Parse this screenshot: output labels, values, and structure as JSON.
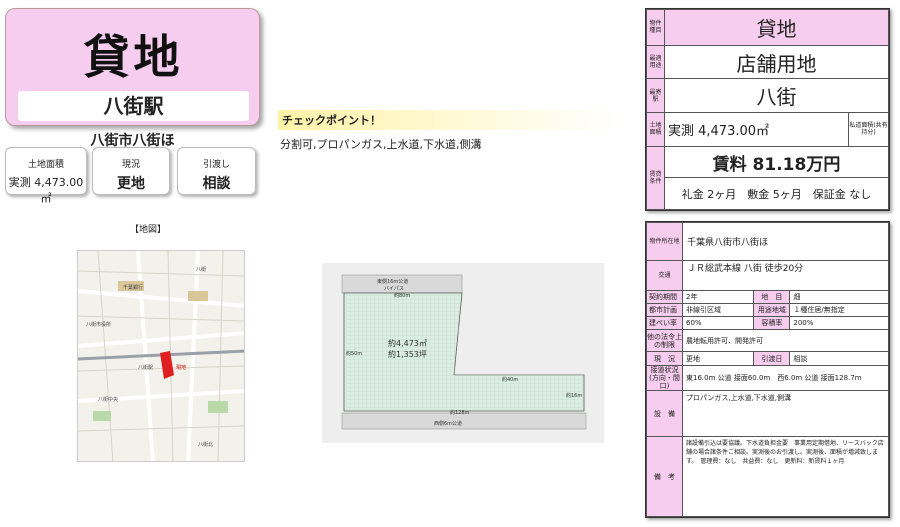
{
  "title": {
    "main": "貸地",
    "station": "八街駅"
  },
  "address_short": "八街市八街ほ",
  "info_boxes": [
    {
      "label": "土地面積",
      "value": "実測 4,473.00㎡"
    },
    {
      "label": "現況",
      "value": "更地"
    },
    {
      "label": "引渡し",
      "value": "相談"
    }
  ],
  "map": {
    "caption": "【地図】",
    "labels": [
      "八街",
      "千葉銀行",
      "八街市役所",
      "八街駅",
      "現地",
      "八街中央",
      "八街北"
    ]
  },
  "checkpoint": {
    "title": "チェックポイント！",
    "text": "分割可,プロパンガス,上水道,下水道,側溝"
  },
  "plan": {
    "top_road": "東側16m公道",
    "top_note": "バイパス",
    "top_len": "約80m",
    "left_len": "約50m",
    "area_sqm": "約4,473㎡",
    "area_tsubo": "約1,353坪",
    "inner_len": "約40m",
    "right_len": "約16m",
    "bottom_len": "約128m",
    "bottom_road": "西側6m公道"
  },
  "summary": {
    "type_label": "物件種目",
    "type": "貸地",
    "use_label": "最適用途",
    "use": "店舗用地",
    "station_label": "最寄駅",
    "station": "八街",
    "area_label": "土地面積",
    "area": "実測 4,473.00㎡",
    "area_note": "私道面積(共有持分)",
    "rent_label": "賃貸条件",
    "rent": "賃料 81.18万円",
    "conditions": "礼金 2ヶ月　敷金 5ヶ月　保証金 なし"
  },
  "details": {
    "location_label": "物件所在地",
    "location": "千葉県八街市八街ほ",
    "transport_label": "交通",
    "transport": "ＪＲ総武本線 八街 徒歩20分",
    "rows": [
      {
        "l1": "契約期間",
        "v1": "2年",
        "l2": "地　目",
        "v2": "畑"
      },
      {
        "l1": "都市計画",
        "v1": "非線引区域",
        "l2": "用途地域",
        "v2": "１種住居/無指定"
      },
      {
        "l1": "建ぺい率",
        "v1": "60%",
        "l2": "容積率",
        "v2": "200%"
      }
    ],
    "other_label": "他の法令上の制限",
    "other": "農地転用許可、開発許可",
    "status_label": "現　況",
    "status": "更地",
    "delivery_label": "引渡日",
    "delivery": "相談",
    "road_label": "接道状況(方向・間口)",
    "road": "東16.0m 公道 接面60.0m　西6.0m 公道 接面128.7m",
    "equip_label": "設　備",
    "equip": "プロパンガス,上水道,下水道,側溝",
    "notes_label": "備　考",
    "notes": "諸設備引込は要協議。下水道負担金要　事業用定期借地、リースバック店舗の場合諸条件ご相談。実測後のお引渡し。実測後、面積が増減致します。　管理費：なし　共益費：なし　更新料：新賃料１ヶ月"
  },
  "colors": {
    "accent_pink": "#f6cdee",
    "check_yellow": "#fff3a8",
    "plan_green": "#d8ecd0"
  }
}
